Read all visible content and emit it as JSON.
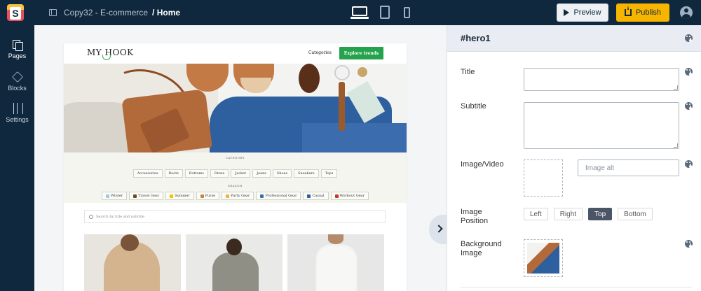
{
  "topbar": {
    "logo_letter": "S",
    "project": "Copy32 - E-commerce",
    "page": "/ Home",
    "devices": [
      "desktop-icon",
      "tablet-icon",
      "phone-icon"
    ],
    "preview_label": "Preview",
    "publish_label": "Publish"
  },
  "sidebar": {
    "items": [
      {
        "label": "Pages",
        "icon": "pages-icon"
      },
      {
        "label": "Blocks",
        "icon": "blocks-icon"
      },
      {
        "label": "Settings",
        "icon": "settings-icon"
      }
    ]
  },
  "site": {
    "brand": "MY HOOK",
    "nav_link": "Categories",
    "nav_button": "Explore trends",
    "category_label": "CATEGORY",
    "categories": [
      "Accessories",
      "Boots",
      "Bottoms",
      "Dress",
      "Jacket",
      "Jeans",
      "Shoes",
      "Sneakers",
      "Tops"
    ],
    "season_label": "SEASON",
    "seasons": [
      "Winter",
      "Travel Gear",
      "Summer",
      "Purse",
      "Party Gear",
      "Professional Gear",
      "Casual",
      "Workout Gear"
    ],
    "search_placeholder": "Search by title and subtitle"
  },
  "panel": {
    "title": "#hero1",
    "fields": {
      "title_label": "Title",
      "subtitle_label": "Subtitle",
      "image_label": "Image/Video",
      "image_alt_placeholder": "Image alt",
      "position_label": "Image Position",
      "position_options": [
        "Left",
        "Right",
        "Top",
        "Bottom"
      ],
      "position_selected": "Top",
      "bg_label": "Background Image"
    }
  },
  "colors": {
    "topbar": "#10283d",
    "publish": "#f7b500",
    "site_button": "#24a24c"
  }
}
